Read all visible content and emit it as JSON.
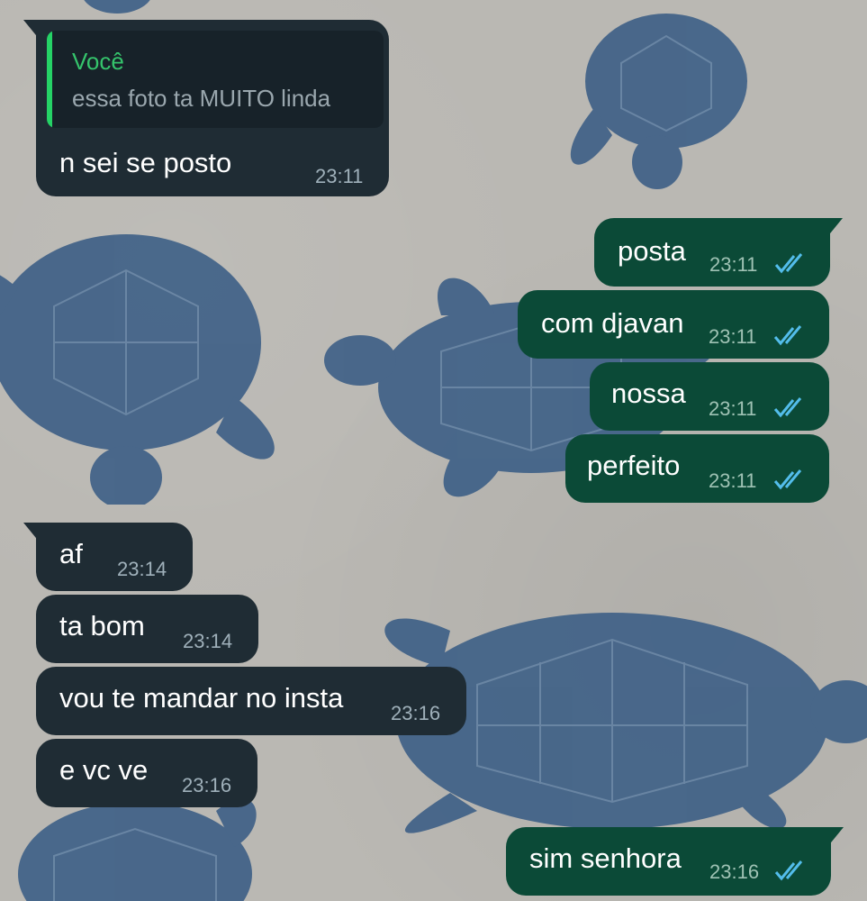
{
  "colors": {
    "incoming_bubble": "#1f2c34",
    "outgoing_bubble": "#0b4a37",
    "quote_bar": "#25d366",
    "quote_author": "#35c46c",
    "read_ticks": "#53bdeb",
    "wallpaper_background": "#bab8b3",
    "wallpaper_turtles": "#3d5f86"
  },
  "wallpaper": {
    "motif": "sea-turtle-illustration"
  },
  "messages": [
    {
      "direction": "incoming",
      "quoted": {
        "author": "Você",
        "text": "essa foto ta MUITO linda"
      },
      "text": "n sei se posto",
      "time": "23:11"
    },
    {
      "direction": "outgoing",
      "text": "posta",
      "time": "23:11",
      "status": "read",
      "status_icon": "double-check-icon"
    },
    {
      "direction": "outgoing",
      "text": "com djavan",
      "time": "23:11",
      "status": "read",
      "status_icon": "double-check-icon"
    },
    {
      "direction": "outgoing",
      "text": "nossa",
      "time": "23:11",
      "status": "read",
      "status_icon": "double-check-icon"
    },
    {
      "direction": "outgoing",
      "text": "perfeito",
      "time": "23:11",
      "status": "read",
      "status_icon": "double-check-icon"
    },
    {
      "direction": "incoming",
      "text": "af",
      "time": "23:14"
    },
    {
      "direction": "incoming",
      "text": "ta bom",
      "time": "23:14"
    },
    {
      "direction": "incoming",
      "text": "vou te mandar no insta",
      "time": "23:16"
    },
    {
      "direction": "incoming",
      "text": "e vc ve",
      "time": "23:16"
    },
    {
      "direction": "outgoing",
      "text": "sim senhora",
      "time": "23:16",
      "status": "read",
      "status_icon": "double-check-icon"
    }
  ]
}
